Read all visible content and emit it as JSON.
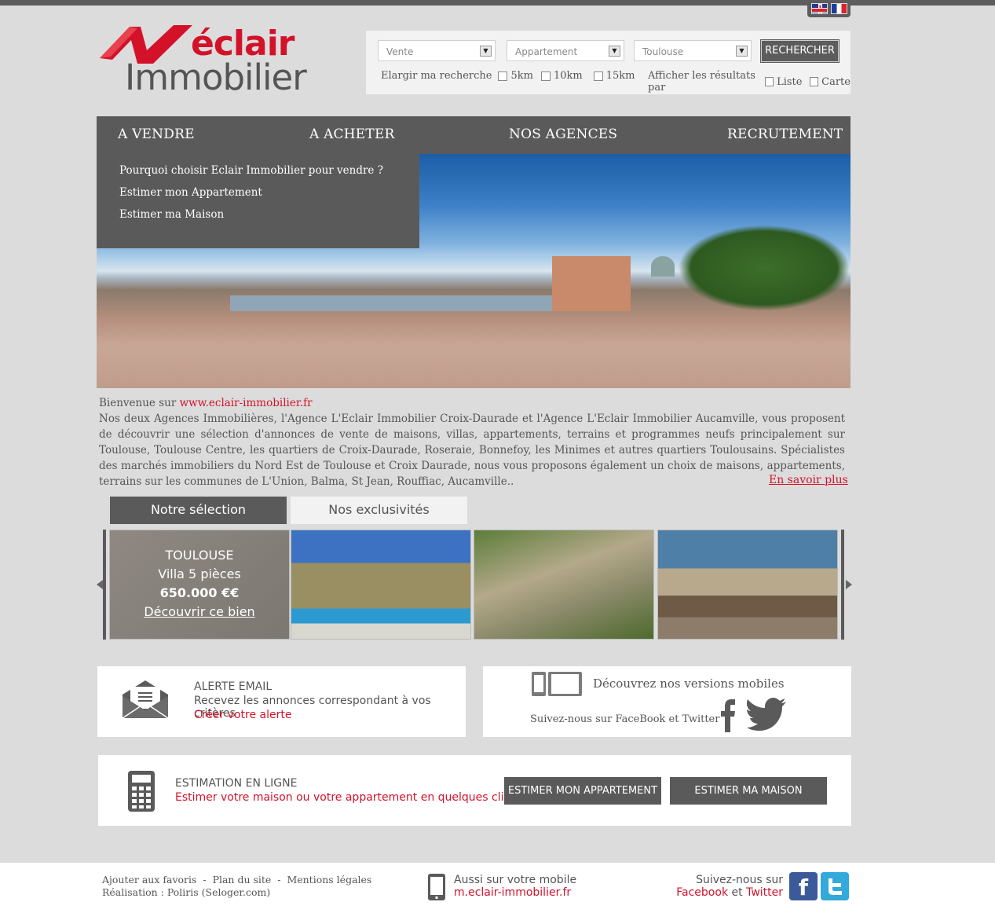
{
  "search": {
    "transaction": "Vente",
    "type": "Appartement",
    "city": "Toulouse",
    "button": "RECHERCHER",
    "widen_label": "Elargir ma recherche",
    "radius": [
      "5km",
      "10km",
      "15km"
    ],
    "display_label": "Afficher les résultats par",
    "display_list": "Liste",
    "display_map": "Carte"
  },
  "logo": {
    "line1": "éclair",
    "line2": "Immobilier"
  },
  "nav": {
    "items": [
      "A VENDRE",
      "A ACHETER",
      "NOS AGENCES",
      "RECRUTEMENT"
    ],
    "dropdown": [
      "Pourquoi choisir Eclair Immobilier pour vendre ?",
      "Estimer mon Appartement",
      "Estimer ma Maison"
    ]
  },
  "intro": {
    "welcome": "Bienvenue sur ",
    "site": "www.eclair-immobilier.fr",
    "text": "Nos deux Agences Immobilières, l'Agence L'Eclair Immobilier Croix-Daurade et l'Agence L'Eclair Immobilier Aucamville, vous proposent de découvrir une sélection d'annonces de vente de maisons, villas, appartements, terrains et programmes neufs principalement sur Toulouse, Toulouse Centre, les quartiers de Croix-Daurade, Roseraie, Bonnefoy, les Minimes et autres quartiers Toulousains. Spécialistes des marchés immobiliers du Nord Est de Toulouse et Croix Daurade, nous vous proposons également un choix de maisons, appartements, terrains sur les communes de L'Union, Balma, St Jean, Rouffiac, Aucamville..",
    "more": "En savoir plus"
  },
  "tabs": {
    "selection": "Notre sélection",
    "exclusives": "Nos exclusivités"
  },
  "featured": {
    "city": "TOULOUSE",
    "title": "Villa 5 pièces",
    "price": "650.000 €€",
    "link": "Découvrir ce bien"
  },
  "alert": {
    "title": "ALERTE EMAIL",
    "text": "Recevez les annonces correspondant à vos critères",
    "link": "Créer votre alerte"
  },
  "mobile": {
    "title": "Découvrez nos versions mobiles",
    "social": "Suivez-nous sur FaceBook et Twitter"
  },
  "estimation": {
    "title": "ESTIMATION EN LIGNE",
    "text": "Estimer votre maison ou votre appartement en quelques clics !",
    "btn_apartment": "ESTIMER MON APPARTEMENT",
    "btn_house": "ESTIMER MA MAISON"
  },
  "footer": {
    "favorites": "Ajouter aux favoris",
    "sitemap": "Plan du site",
    "legal": "Mentions légales",
    "credit": "Réalisation : Poliris (Seloger.com)",
    "mobile_line1": "Aussi sur votre mobile",
    "mobile_url": "m.eclair-immobilier.fr",
    "follow": "Suivez-nous sur",
    "facebook": "Facebook",
    "and": "et",
    "twitter": "Twitter"
  },
  "colors": {
    "brand_red": "#d3122a",
    "nav_gray": "#5a5a5b",
    "page_bg": "#dcdcdc"
  }
}
